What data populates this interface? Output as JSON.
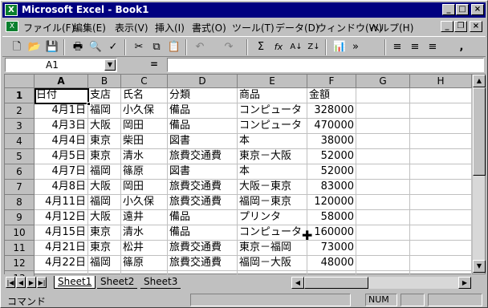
{
  "window": {
    "title": "Microsoft Excel - Book1",
    "icon": "X"
  },
  "menu": [
    "ファイル(F)",
    "編集(E)",
    "表示(V)",
    "挿入(I)",
    "書式(O)",
    "ツール(T)",
    "データ(D)",
    "ウィンドウ(W)",
    "ヘルプ(H)"
  ],
  "toolbar": [
    "🗋",
    "📂",
    "💾",
    "🖶",
    "🔍",
    "✓",
    "✂",
    "⧉",
    "📋",
    "↶",
    "↷",
    "Σ",
    "fx",
    "A↓",
    "Z↓",
    "📊",
    "»",
    "≡",
    "≡",
    "≡",
    ","
  ],
  "formula": {
    "namebox": "A1",
    "eq": "=",
    "content": ""
  },
  "columns": [
    "A",
    "B",
    "C",
    "D",
    "E",
    "F",
    "G",
    "H"
  ],
  "rows": [
    [
      "日付",
      "支店",
      "氏名",
      "分類",
      "商品",
      "金額"
    ],
    [
      "4月1日",
      "福岡",
      "小久保",
      "備品",
      "コンピュータ",
      "328000"
    ],
    [
      "4月3日",
      "大阪",
      "岡田",
      "備品",
      "コンピュータ",
      "470000"
    ],
    [
      "4月4日",
      "東京",
      "柴田",
      "図書",
      "本",
      "38000"
    ],
    [
      "4月5日",
      "東京",
      "清水",
      "旅費交通費",
      "東京－大阪",
      "52000"
    ],
    [
      "4月7日",
      "福岡",
      "篠原",
      "図書",
      "本",
      "52000"
    ],
    [
      "4月8日",
      "大阪",
      "岡田",
      "旅費交通費",
      "大阪－東京",
      "83000"
    ],
    [
      "4月11日",
      "福岡",
      "小久保",
      "旅費交通費",
      "福岡－東京",
      "120000"
    ],
    [
      "4月12日",
      "大阪",
      "遠井",
      "備品",
      "プリンタ",
      "58000"
    ],
    [
      "4月15日",
      "東京",
      "清水",
      "備品",
      "コンピュータ",
      "160000"
    ],
    [
      "4月21日",
      "東京",
      "松井",
      "旅費交通費",
      "東京－福岡",
      "73000"
    ],
    [
      "4月22日",
      "福岡",
      "篠原",
      "旅費交通費",
      "福岡－大阪",
      "48000"
    ],
    [
      "",
      "",
      "",
      "",
      "",
      ""
    ]
  ],
  "tabs": [
    "Sheet1",
    "Sheet2",
    "Sheet3"
  ],
  "status": {
    "mode": "コマンド",
    "num": "NUM"
  }
}
